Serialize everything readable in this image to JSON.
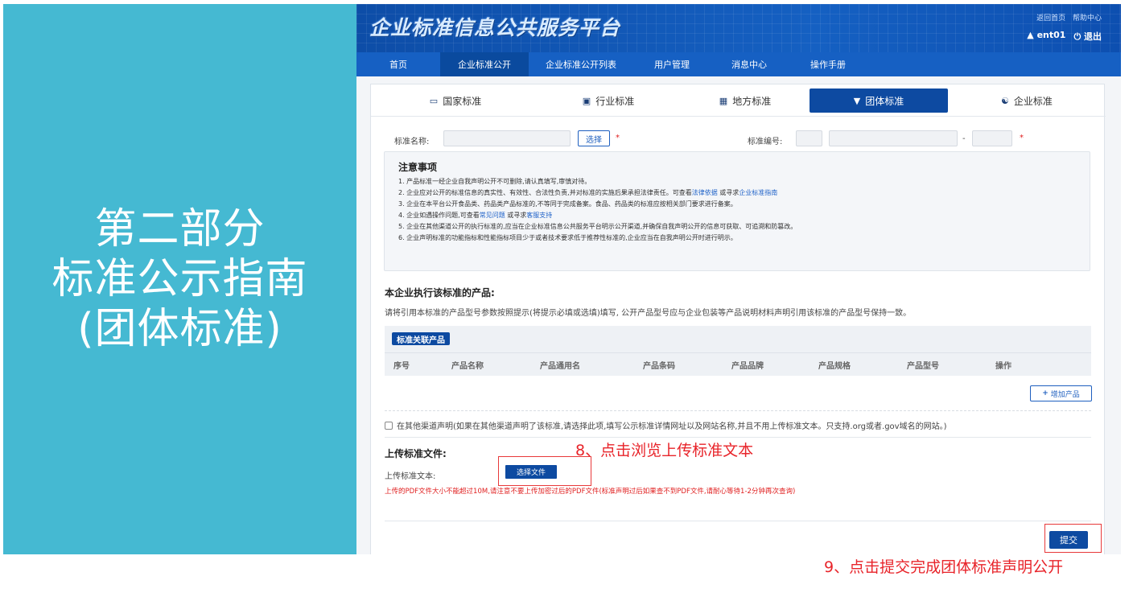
{
  "left_panel": {
    "lines": [
      "第二部分",
      "标准公示指南",
      "(团体标准)"
    ],
    "bg_color": "#45b9d2"
  },
  "header": {
    "site_title": "企业标准信息公共服务平台",
    "top_links": [
      "返回首页",
      "帮助中心"
    ],
    "user": "ent01",
    "logout": "退出"
  },
  "nav": {
    "items": [
      "首页",
      "企业标准公开",
      "企业标准公开列表",
      "用户管理",
      "消息中心",
      "操作手册"
    ],
    "active": "企业标准公开"
  },
  "type_tabs": {
    "items": [
      {
        "label": "国家标准",
        "icon": "book-icon"
      },
      {
        "label": "行业标准",
        "icon": "briefcase-icon"
      },
      {
        "label": "地方标准",
        "icon": "document-icon"
      },
      {
        "label": "团体标准",
        "icon": "shield-icon"
      },
      {
        "label": "企业标准",
        "icon": "bank-icon"
      }
    ],
    "active": "团体标准"
  },
  "form": {
    "std_name_label": "标准名称:",
    "choose_label": "选择",
    "required_mark": "*",
    "std_no_label": "标准编号:",
    "dash": "-"
  },
  "notice": {
    "title": "注意事项",
    "lines": [
      {
        "text": "1. 产品标准一经企业自我声明公开不可删除,请认真填写,审慎对待。"
      },
      {
        "text": "2. 企业应对公开的标准信息的真实性、有效性、合法性负责,并对标准的实施后果承担法律责任。可查看",
        "link1": "法律依据",
        "mid": " 或寻求",
        "link2": "企业标准指南"
      },
      {
        "text": "3. 企业在本平台公开食品类、药品类产品标准的,不等同于完成备案。食品、药品类的标准应按相关部门要求进行备案。"
      },
      {
        "text": "4. 企业如遇操作问题,可查看",
        "link1": "常见问题",
        "mid": " 或寻求",
        "link2": "客服支持"
      },
      {
        "text": "5. 企业在其他渠道公开的执行标准的,应当在企业标准信息公共服务平台明示公开渠道,并确保自我声明公开的信息可获取、可追溯和防篡改。"
      },
      {
        "text": "6. 企业声明标准的功能指标和性能指标项目少于或者技术要求低于推荐性标准的,企业应当在自我声明公开时进行明示。"
      }
    ]
  },
  "products": {
    "heading": "本企业执行该标准的产品:",
    "tip": "请将引用本标准的产品型号参数按照提示(将提示必填或选填)填写, 公开产品型号应与企业包装等产品说明材料声明引用该标准的产品型号保持一致。",
    "badge": "标准关联产品",
    "columns": [
      "序号",
      "产品名称",
      "产品通用名",
      "产品条码",
      "产品品牌",
      "产品规格",
      "产品型号",
      "操作"
    ],
    "add_button": "增加产品"
  },
  "other_channel": {
    "label": "在其他渠道声明(如果在其他渠道声明了该标准,请选择此项,填写公示标准详情网址以及网站名称,并且不用上传标准文本。只支持.org或者.gov域名的网站。)",
    "checked": false
  },
  "upload": {
    "heading": "上传标准文件:",
    "label": "上传标准文本:",
    "choose_file": "选择文件",
    "warning": "上传的PDF文件大小不能超过10M,请注意不要上传加密过后的PDF文件(标准声明过后如果查不到PDF文件,请耐心等待1-2分钟再次查询)"
  },
  "submit_label": "提交",
  "annotations": {
    "step8": "8、点击浏览上传标准文本",
    "step9": "9、点击提交完成团体标准声明公开",
    "color": "#e8242a"
  }
}
